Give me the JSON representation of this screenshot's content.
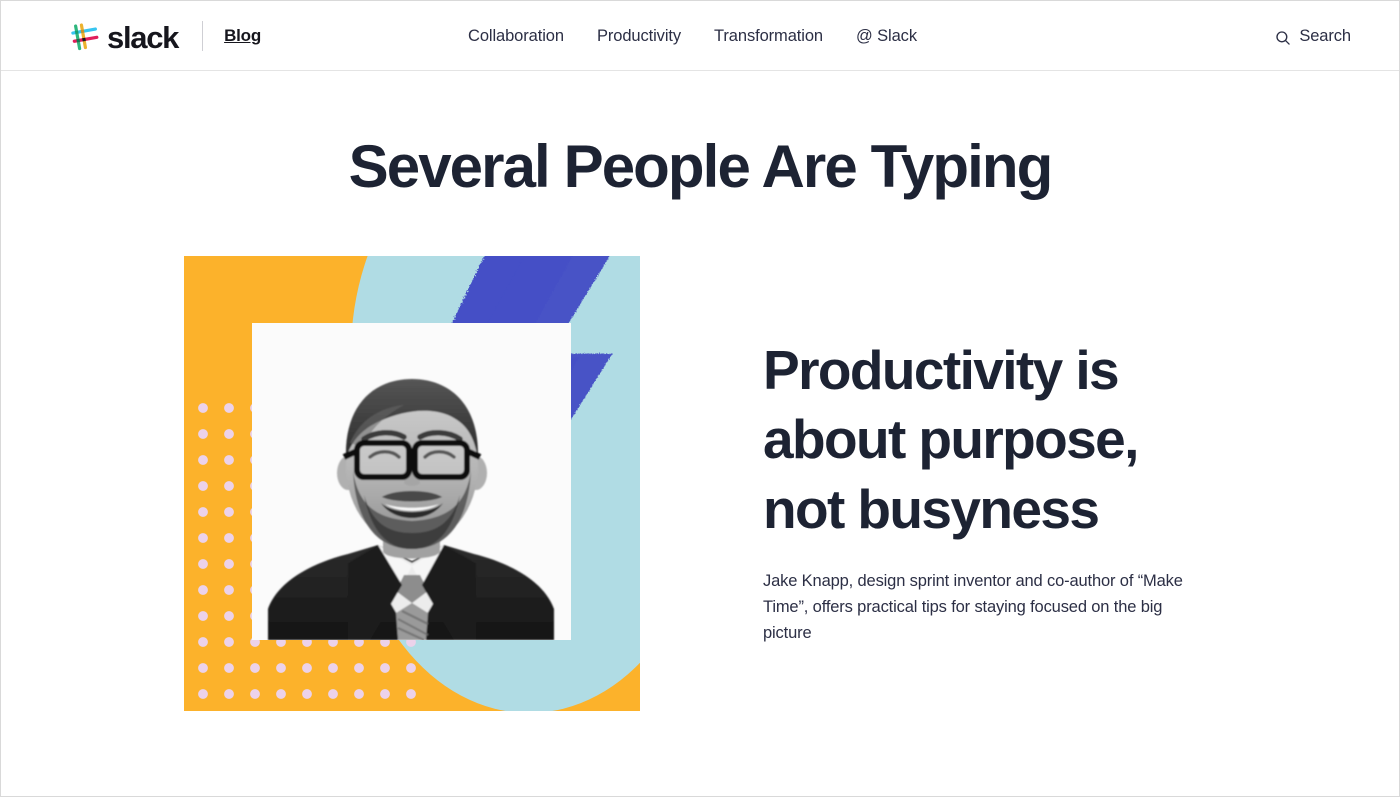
{
  "header": {
    "logo_icon": "slack-hash-logo-icon",
    "wordmark": "slack",
    "section_label": "Blog",
    "nav_items": [
      {
        "label": "Collaboration"
      },
      {
        "label": "Productivity"
      },
      {
        "label": "Transformation"
      },
      {
        "label": "@ Slack"
      }
    ],
    "search": {
      "icon": "search-icon",
      "label": "Search"
    }
  },
  "page": {
    "title": "Several People Are Typing"
  },
  "feature": {
    "headline": "Productivity is about purpose, not busyness",
    "excerpt": "Jake Knapp, design sprint inventor and co-author of “Make Time”, offers practical tips for staying focused on the big picture",
    "artwork": {
      "alt": "Black and white portrait of a smiling bearded man with glasses on a collage of orange, light blue and blue shapes",
      "photo_subject": "Jake Knapp portrait",
      "shapes": [
        "orange-background",
        "light-blue-arc",
        "blue-brush-stroke",
        "pink-polka-dots",
        "white-photo-card"
      ]
    }
  },
  "colors": {
    "orange": "#FCB22B",
    "light_blue": "#B0DCE4",
    "blue_stroke": "#4450C6",
    "dot_pink": "#ECD2EA",
    "ink": "#1D2333",
    "body_text": "#2C2F45",
    "page_bg": "#FFFFFF",
    "border": "#E4E4E4",
    "slack_logo_yellow": "#ECB22E",
    "slack_logo_green": "#2EB67D",
    "slack_logo_blue": "#36C5F0",
    "slack_logo_red": "#E01E5A"
  }
}
